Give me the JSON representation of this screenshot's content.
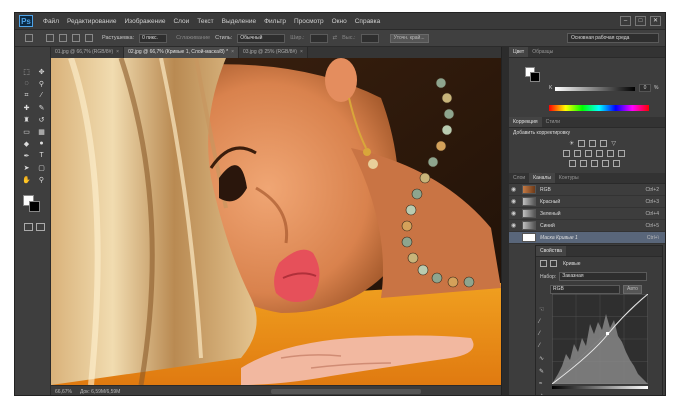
{
  "app": {
    "logo": "Ps"
  },
  "menu": [
    "Файл",
    "Редактирование",
    "Изображение",
    "Слои",
    "Текст",
    "Выделение",
    "Фильтр",
    "Просмотр",
    "Окно",
    "Справка"
  ],
  "window_controls": [
    "–",
    "□",
    "✕"
  ],
  "options_bar": {
    "feather_label": "Растушевка:",
    "feather_value": "0 пикс.",
    "antialias_label": "Сглаживание",
    "style_label": "Стиль:",
    "style_value": "Обычный",
    "width_label": "Шир.:",
    "height_label": "Выс.:",
    "refine_button": "Уточн. край...",
    "workspace": "Основная рабочая среда"
  },
  "tabs": [
    {
      "label": "01.jpg @ 66,7% (RGB/8#)",
      "active": false
    },
    {
      "label": "02.jpg @ 66,7% (Кривые 1, Слой-маска/8) *",
      "active": true
    },
    {
      "label": "03.jpg @ 25% (RGB/8#)",
      "active": false
    }
  ],
  "status": {
    "zoom": "66,67%",
    "doc": "Док: 6,59M/6,59M"
  },
  "panels": {
    "color_tabs": [
      "Цвет",
      "Образцы"
    ],
    "color_k_label": "K",
    "color_k_value": "0",
    "color_k_pct": "%",
    "corr_tabs": [
      "Коррекция",
      "Стили"
    ],
    "corr_title": "Добавить корректировку",
    "layers_tabs": [
      "Слои",
      "Каналы",
      "Контуры"
    ],
    "channels": [
      {
        "name": "RGB",
        "shortcut": "Ctrl+2",
        "thumb": "color"
      },
      {
        "name": "Красный",
        "shortcut": "Ctrl+3",
        "thumb": "gray"
      },
      {
        "name": "Зеленый",
        "shortcut": "Ctrl+4",
        "thumb": "gray"
      },
      {
        "name": "Синий",
        "shortcut": "Ctrl+5",
        "thumb": "gray"
      },
      {
        "name": "Маска Кривые 1",
        "shortcut": "Ctrl+\\",
        "thumb": "white"
      }
    ]
  },
  "properties": {
    "tab": "Свойства",
    "adjust_name": "Кривые",
    "preset_label": "Набор:",
    "preset_value": "Заказная",
    "channel_value": "RGB",
    "auto_button": "Авто"
  }
}
